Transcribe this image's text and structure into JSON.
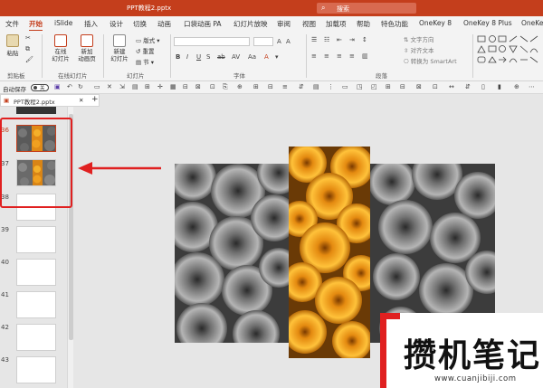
{
  "window": {
    "title": "PPT教程2.pptx",
    "search_text": "搜索"
  },
  "tabs": [
    "文件",
    "开始",
    "iSlide",
    "插入",
    "设计",
    "切换",
    "动画",
    "口袋动画 PA",
    "幻灯片放映",
    "审阅",
    "视图",
    "加载项",
    "帮助",
    "特色功能",
    "OneKey 8",
    "OneKey 8 Plus",
    "OneKe"
  ],
  "active_tab": "开始",
  "ribbon": {
    "clipboard": {
      "paste_label": "粘贴",
      "group_label": "剪贴板"
    },
    "online_slides": {
      "online_label": "在线\n幻灯片",
      "new_anim_label": "新加\n动画页",
      "group_label": "在线幻灯片"
    },
    "slides": {
      "new_slide_label": "新建\n幻灯片",
      "layout_label": "版式",
      "reset_label": "重置",
      "section_label": "节",
      "group_label": "幻灯片"
    },
    "font": {
      "group_label": "字体"
    },
    "paragraph": {
      "text_direction_label": "文字方向",
      "align_text_label": "对齐文本",
      "smartart_label": "转换为 SmartArt",
      "group_label": "段落"
    }
  },
  "qat": {
    "autosave_label": "自动保存",
    "autosave_state": "关"
  },
  "file_tab": {
    "name": "PPT教程2.pptx",
    "add_label": "+"
  },
  "slides_panel": {
    "numbers": [
      "36",
      "37",
      "38",
      "39",
      "40",
      "41",
      "42",
      "43"
    ],
    "selected": "36"
  },
  "watermark": {
    "text": "攒机笔记",
    "url": "www.cuanjibiji.com"
  },
  "colors": {
    "accent": "#c43e1c",
    "highlight": "#e02020"
  }
}
